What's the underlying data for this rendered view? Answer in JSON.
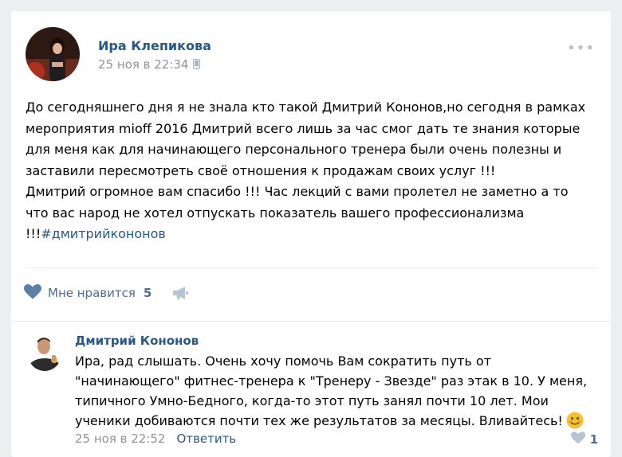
{
  "post": {
    "author": "Ира Клепикова",
    "time": "25 ноя в 22:34",
    "text": "До сегодняшнего дня я не знала кто такой Дмитрий Кононов,но сегодня в рамках\nмероприятия mioff 2016 Дмитрий всего лишь за час смог дать те знания которые\nдля меня как для начинающего персонального тренера были очень полезны и\nзаставили пересмотреть своё отношения к продажам своих услуг !!!\nДмитрий огромное вам спасибо !!! Час лекций с вами пролетел не заметно а то\nчто вас народ не хотел отпускать показатель вашего профессионализма\n!!!",
    "hashtag": "#дмитрийкононов",
    "more_icon": "more-dots-icon",
    "device_icon": "phone-icon"
  },
  "actions": {
    "like_label": "Мне нравится",
    "like_count": "5",
    "like_icon": "heart-icon",
    "share_icon": "megaphone-icon"
  },
  "comment": {
    "author": "Дмитрий Кононов",
    "text": "Ира, рад слышать. Очень хочу помочь Вам сократить путь от\n\"начинающего\" фитнес-тренера к \"Тренеру - Звезде\" раз этак в 10. У меня,\nтипичного Умно-Бедного, когда-то этот путь занял почти 10 лет. Мои\nученики добиваются почти тех же результатов за месяцы. Вливайтесь!",
    "emoji": "smile-emoji",
    "time": "25 ноя в 22:52",
    "reply_label": "Ответить",
    "like_count": "1"
  },
  "colors": {
    "link": "#2a5885",
    "muted": "#939393",
    "action": "#4f6c8c",
    "background": "#edeef0"
  }
}
